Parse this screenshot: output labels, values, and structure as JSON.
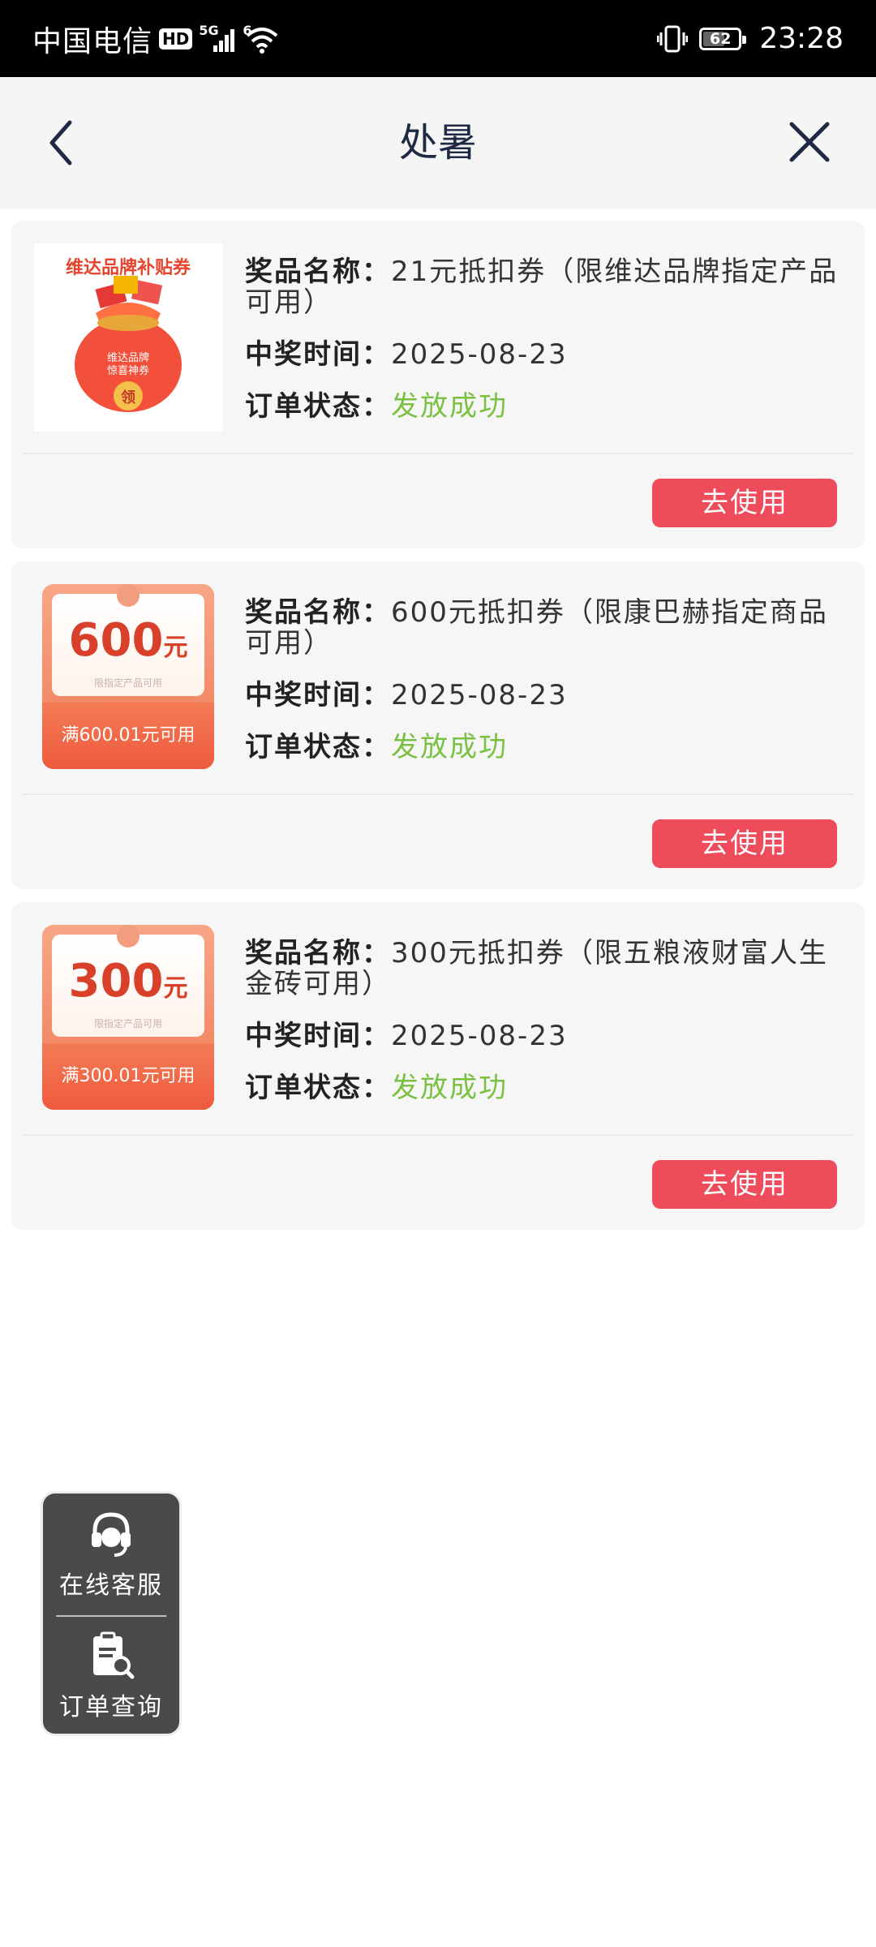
{
  "status_bar": {
    "carrier": "中国电信",
    "hd": "HD",
    "network": "5G",
    "wifi_badge": "6",
    "battery": "62",
    "time": "23:28"
  },
  "nav": {
    "title": "处暑"
  },
  "labels": {
    "name": "奖品名称：",
    "time": "中奖时间：",
    "status": "订单状态：",
    "use_button": "去使用"
  },
  "prizes": [
    {
      "name": "21元抵扣券（限维达品牌指定产品可用）",
      "time": "2025-08-23",
      "status": "发放成功",
      "thumb_title": "维达品牌补贴券",
      "thumb_bag_text": "维达品牌\n惊喜神券",
      "thumb_bag_badge": "领"
    },
    {
      "name": "600元抵扣券（限康巴赫指定商品可用）",
      "time": "2025-08-23",
      "status": "发放成功",
      "coupon_amount": "600",
      "coupon_unit": "元",
      "coupon_note": "限指定产品可用",
      "coupon_condition": "满600.01元可用"
    },
    {
      "name": "300元抵扣券（限五粮液财富人生金砖可用）",
      "time": "2025-08-23",
      "status": "发放成功",
      "coupon_amount": "300",
      "coupon_unit": "元",
      "coupon_note": "限指定产品可用",
      "coupon_condition": "满300.01元可用"
    }
  ],
  "floating_panel": {
    "service_label": "在线客服",
    "order_label": "订单查询"
  },
  "colors": {
    "button": "#ee4b5b",
    "status_ok": "#7ac143",
    "title": "#1e2a44"
  }
}
